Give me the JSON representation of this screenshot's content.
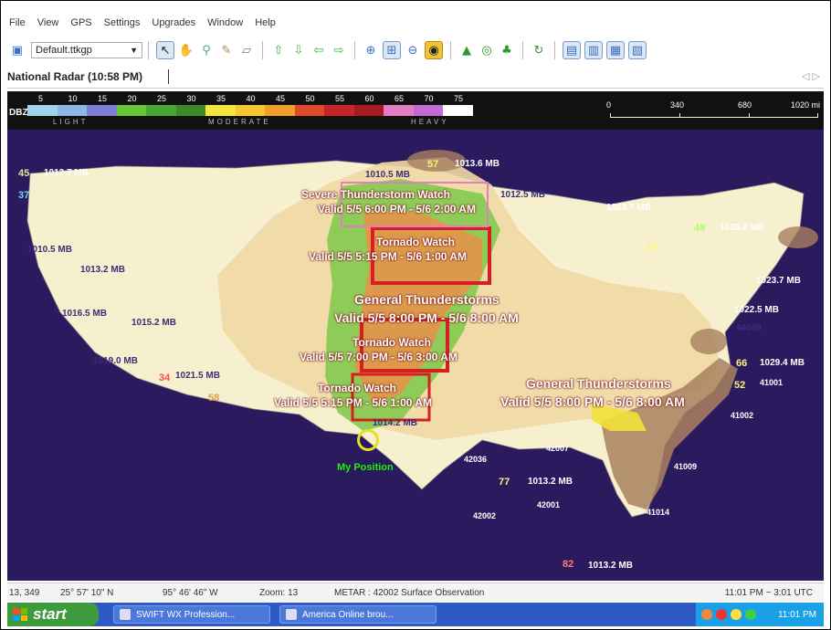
{
  "menu": [
    "File",
    "View",
    "GPS",
    "Settings",
    "Upgrades",
    "Window",
    "Help"
  ],
  "toolbar": {
    "map_select": "Default.ttkgp"
  },
  "tab": {
    "title": "National Radar (10:58 PM)",
    "nav": "◁ ▷"
  },
  "legend": {
    "unit": "DBZ",
    "ticks": [
      "5",
      "10",
      "15",
      "20",
      "25",
      "30",
      "35",
      "40",
      "45",
      "50",
      "55",
      "60",
      "65",
      "70",
      "75"
    ],
    "bands": [
      "LIGHT",
      "MODERATE",
      "HEAVY"
    ],
    "colors": [
      "#9fd3ee",
      "#8fb6e8",
      "#7d7ed6",
      "#69c436",
      "#4aa632",
      "#3b8a2a",
      "#f5e63a",
      "#f3c72d",
      "#efa028",
      "#e04a2a",
      "#c8232a",
      "#a81a22",
      "#e27cc5",
      "#c46ad6",
      "#ffffff"
    ]
  },
  "scale": {
    "labels": [
      "0",
      "340",
      "680",
      "1020 mi"
    ]
  },
  "map": {
    "warnings": [
      "Severe Thunderstorm Watch",
      "Valid 5/5 6:00 PM - 5/6 2:00 AM",
      "Tornado Watch",
      "Valid 5/5 5:15 PM - 5/6 1:00 AM",
      "General Thunderstorms",
      "Valid 5/5 8:00 PM - 5/6 8:00 AM",
      "Tornado Watch",
      "Valid 5/5 7:00 PM - 5/6 3:00 AM",
      "Tornado Watch",
      "Valid 5/5 5:15 PM - 5/6 1:00 AM",
      "General Thunderstorms",
      "Valid 5/5 8:00 PM - 5/6 8:00 AM"
    ],
    "pressure": [
      "1013.7 MB",
      "1010.5 MB",
      "1013.6 MB",
      "1012.5 MB",
      "1023.7 MB",
      "1028.8 MB",
      "1023.7 MB",
      "1022.5 MB",
      "1029.4 MB",
      "1013.2 MB",
      "1013.2 MB",
      "1010.5 MB",
      "1013.2 MB",
      "1016.5 MB",
      "1015.2 MB",
      "1019.0 MB",
      "1021.5 MB",
      "1014.2 MB"
    ],
    "buoys": [
      "44009",
      "41001",
      "41002",
      "41009",
      "42036",
      "42007",
      "42001",
      "42002",
      "41014"
    ],
    "temps": [
      "45",
      "37",
      "57",
      "48",
      "67",
      "66",
      "52",
      "77",
      "82",
      "34",
      "58"
    ],
    "my_position": "My Position"
  },
  "status": {
    "xy": "13, 349",
    "lat": "25° 57' 10\" N",
    "lon": "95° 46' 46\" W",
    "zoom": "Zoom: 13",
    "metar": "METAR : 42002 Surface Observation",
    "time_range": "11:01 PM ~ 3:01 UTC"
  },
  "taskbar": {
    "start": "start",
    "tasks": [
      "SWIFT WX Profession...",
      "America Online brou..."
    ],
    "clock": "11:01 PM"
  }
}
